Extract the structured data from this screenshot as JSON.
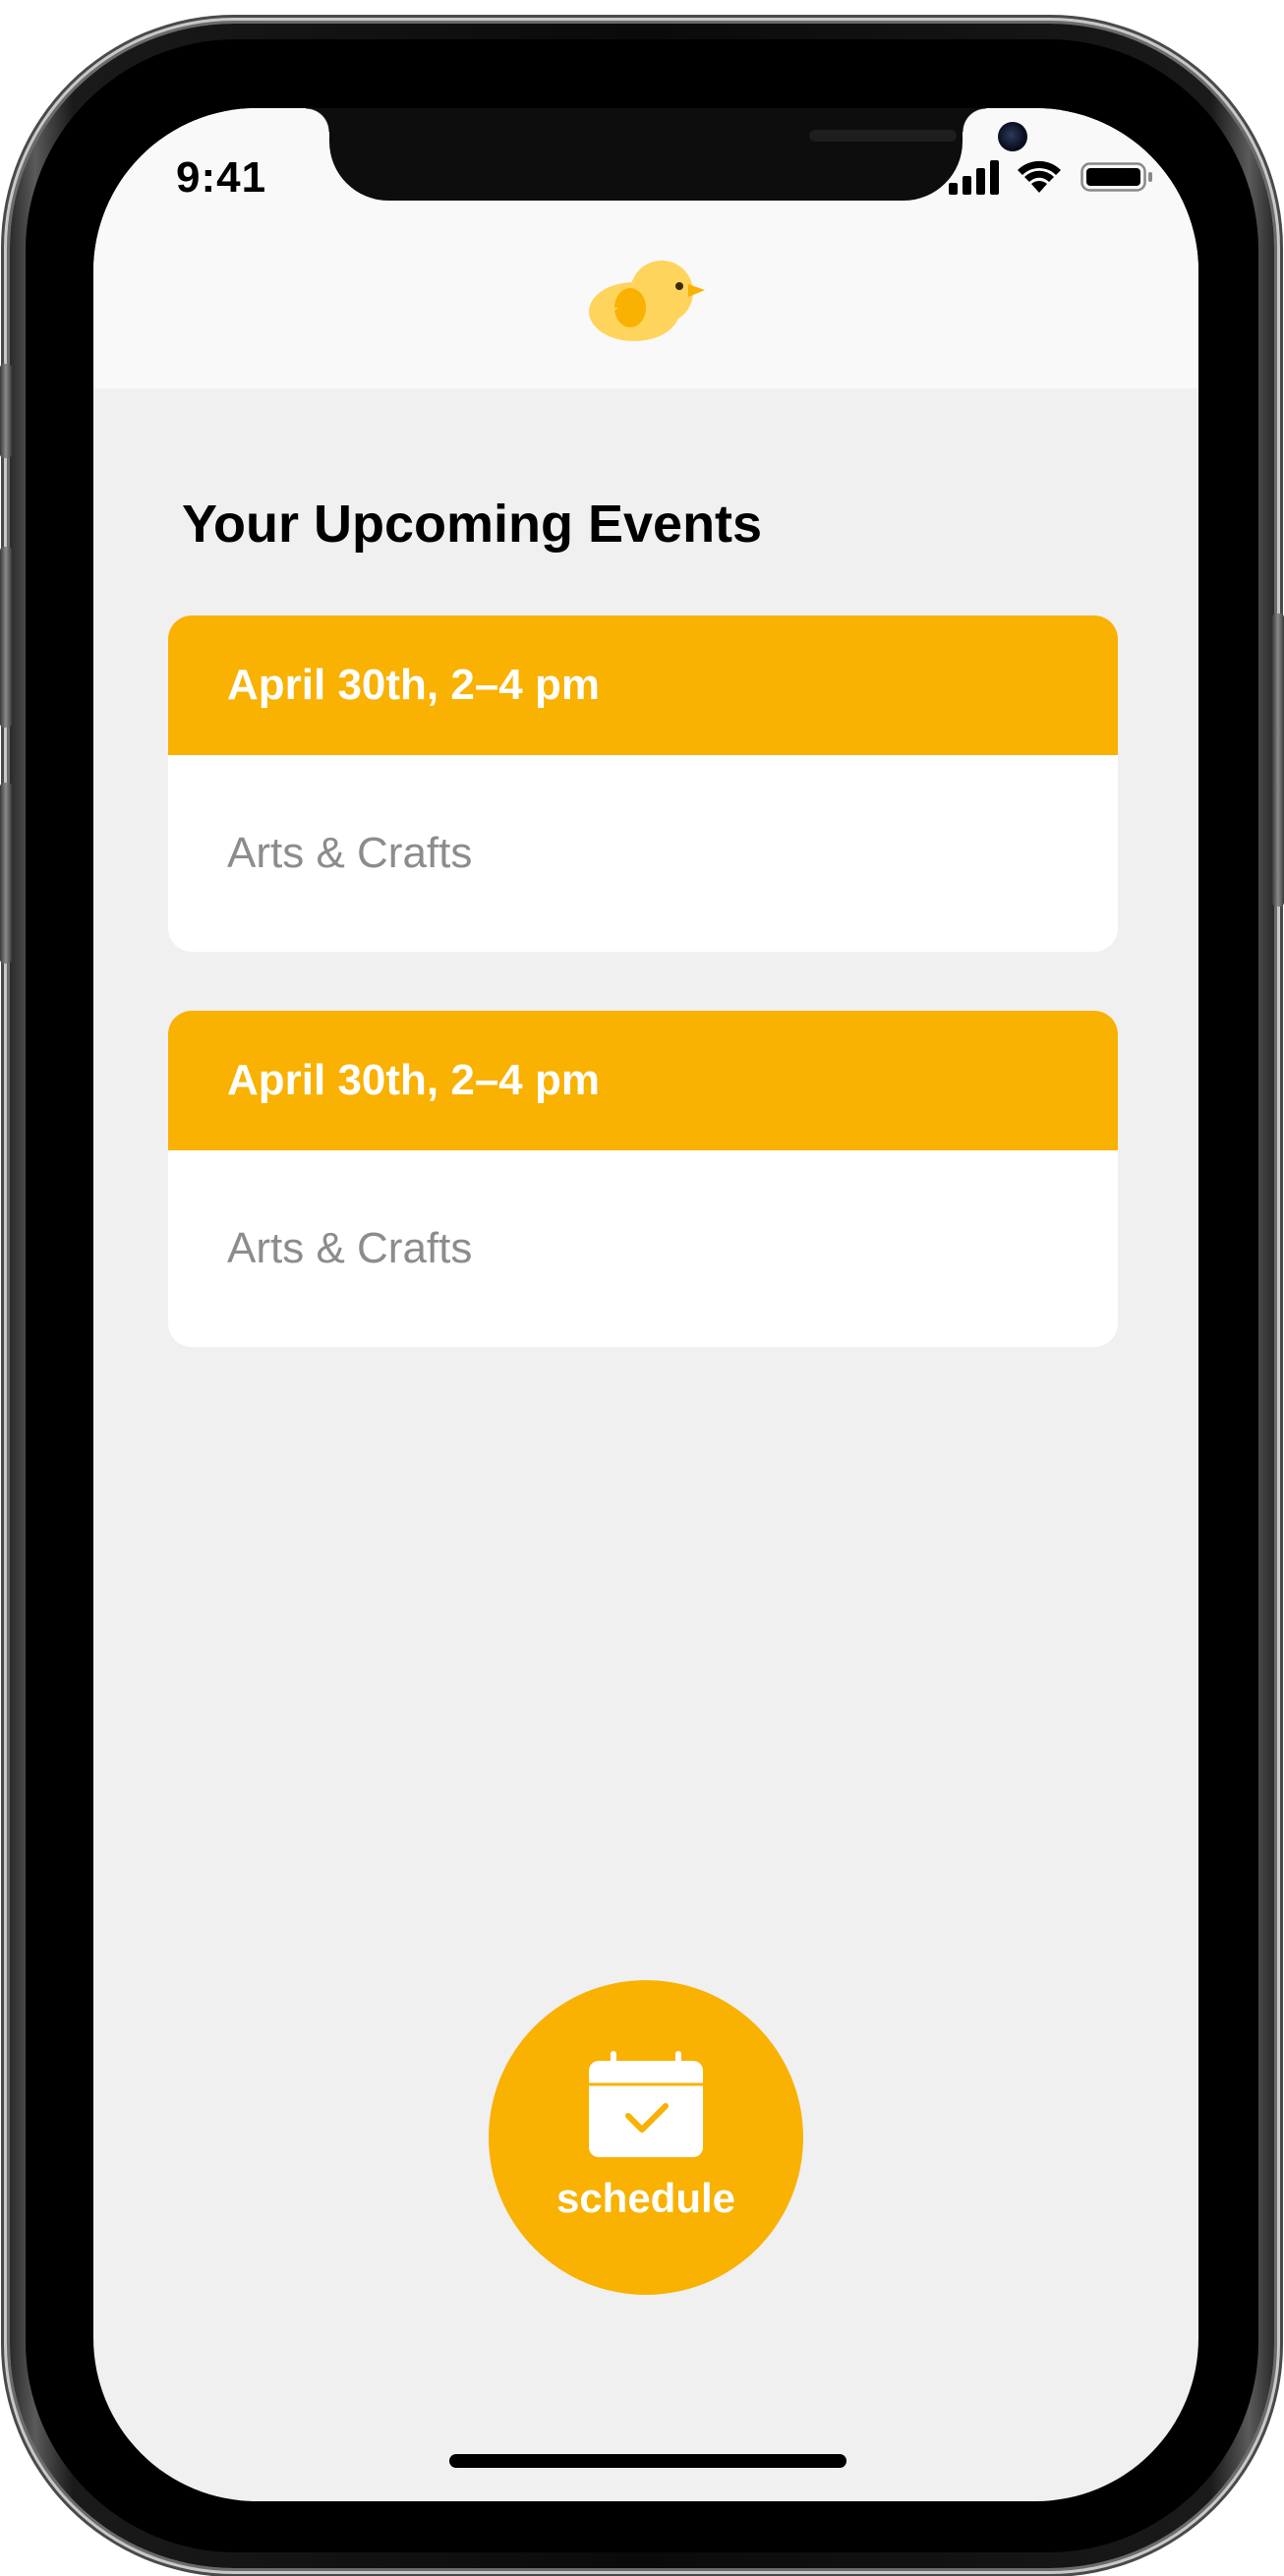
{
  "status_bar": {
    "time": "9:41",
    "icons": [
      "signal-icon",
      "wifi-icon",
      "battery-icon"
    ]
  },
  "header": {
    "logo_icon": "bird-logo-icon"
  },
  "main": {
    "title": "Your Upcoming Events",
    "events": [
      {
        "date": "April 30th, 2–4 pm",
        "activity": "Arts & Crafts"
      },
      {
        "date": "April 30th, 2–4 pm",
        "activity": "Arts & Crafts"
      }
    ]
  },
  "schedule_button": {
    "label": "schedule",
    "icon": "calendar-check-icon"
  },
  "colors": {
    "accent": "#f9b102",
    "background": "#f0f0f0",
    "header_background": "#f9f9f9",
    "card_background": "#ffffff",
    "muted_text": "#8c8c8c",
    "logo_yellow": "#ffd45c",
    "logo_orange": "#f9b102"
  }
}
